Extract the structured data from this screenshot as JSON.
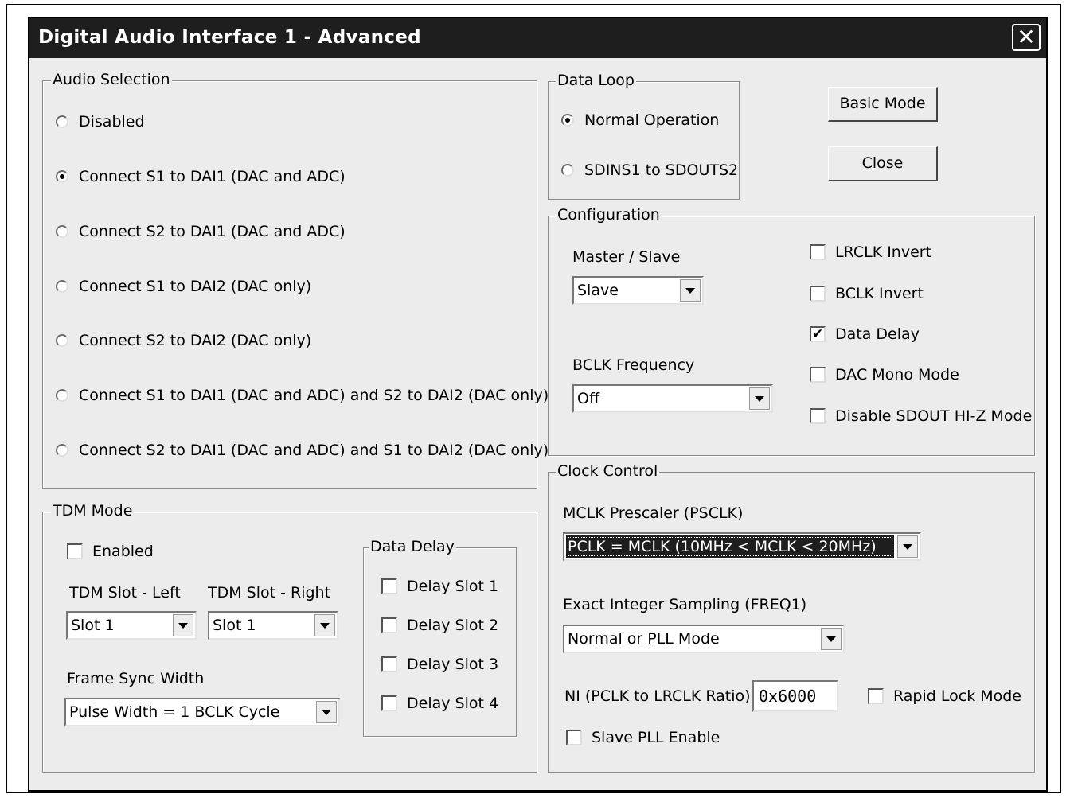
{
  "window": {
    "title": "Digital Audio Interface 1 - Advanced",
    "close_glyph": "✕"
  },
  "audio_selection": {
    "label": "Audio Selection",
    "options": [
      {
        "label": "Disabled",
        "selected": false
      },
      {
        "label": "Connect S1 to DAI1 (DAC and ADC)",
        "selected": true
      },
      {
        "label": "Connect S2 to DAI1 (DAC and ADC)",
        "selected": false
      },
      {
        "label": "Connect S1 to DAI2 (DAC only)",
        "selected": false
      },
      {
        "label": "Connect S2 to DAI2 (DAC only)",
        "selected": false
      },
      {
        "label": "Connect S1 to DAI1 (DAC and ADC) and S2 to DAI2 (DAC only)",
        "selected": false
      },
      {
        "label": "Connect S2 to DAI1 (DAC and ADC) and S1 to DAI2 (DAC only)",
        "selected": false
      }
    ]
  },
  "data_loop": {
    "label": "Data Loop",
    "options": [
      {
        "label": "Normal Operation",
        "selected": true
      },
      {
        "label": "SDINS1 to SDOUTS2",
        "selected": false
      }
    ]
  },
  "buttons": {
    "basic_mode": "Basic Mode",
    "close": "Close"
  },
  "configuration": {
    "label": "Configuration",
    "master_slave": {
      "label": "Master / Slave",
      "value": "Slave"
    },
    "bclk_frequency": {
      "label": "BCLK Frequency",
      "value": "Off"
    },
    "checks": [
      {
        "label": "LRCLK Invert",
        "checked": false
      },
      {
        "label": "BCLK Invert",
        "checked": false
      },
      {
        "label": "Data Delay",
        "checked": true
      },
      {
        "label": "DAC Mono Mode",
        "checked": false
      },
      {
        "label": "Disable SDOUT HI-Z Mode",
        "checked": false
      }
    ]
  },
  "tdm_mode": {
    "label": "TDM Mode",
    "enabled": {
      "label": "Enabled",
      "checked": false
    },
    "slot_left": {
      "label": "TDM Slot - Left",
      "value": "Slot 1"
    },
    "slot_right": {
      "label": "TDM Slot - Right",
      "value": "Slot 1"
    },
    "frame_sync": {
      "label": "Frame Sync Width",
      "value": "Pulse Width = 1 BCLK Cycle"
    },
    "data_delay": {
      "label": "Data Delay",
      "slots": [
        {
          "label": "Delay Slot 1",
          "checked": false
        },
        {
          "label": "Delay Slot 2",
          "checked": false
        },
        {
          "label": "Delay Slot 3",
          "checked": false
        },
        {
          "label": "Delay Slot 4",
          "checked": false
        }
      ]
    }
  },
  "clock_control": {
    "label": "Clock Control",
    "prescaler": {
      "label": "MCLK Prescaler (PSCLK)",
      "value": "PCLK = MCLK (10MHz < MCLK < 20MHz)"
    },
    "freq1": {
      "label": "Exact Integer Sampling (FREQ1)",
      "value": "Normal or PLL Mode"
    },
    "ni": {
      "label": "NI (PCLK to LRCLK Ratio)",
      "value": "0x6000"
    },
    "rapid_lock": {
      "label": "Rapid Lock Mode",
      "checked": false
    },
    "slave_pll": {
      "label": "Slave PLL Enable",
      "checked": false
    }
  },
  "check_glyph": "✔"
}
